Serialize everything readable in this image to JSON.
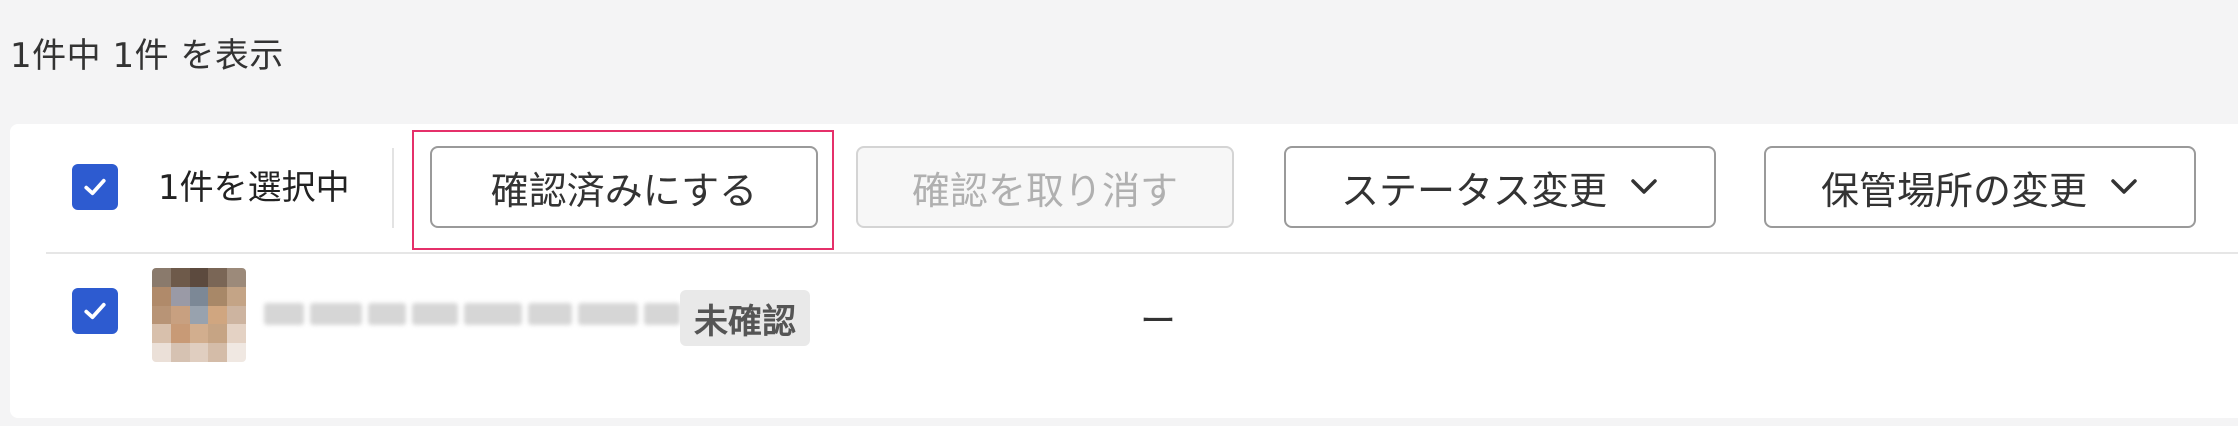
{
  "summary": {
    "count_text": "1件中 1件 を表示"
  },
  "toolbar": {
    "selected_text": "1件を選択中",
    "confirm_label": "確認済みにする",
    "cancel_confirm_label": "確認を取り消す",
    "status_change_label": "ステータス変更",
    "location_change_label": "保管場所の変更"
  },
  "rows": [
    {
      "status_badge": "未確認",
      "value": "ー"
    }
  ],
  "colors": {
    "accent": "#2d5bd0",
    "highlight": "#e5306a",
    "disabled_text": "#b0b0b0"
  }
}
